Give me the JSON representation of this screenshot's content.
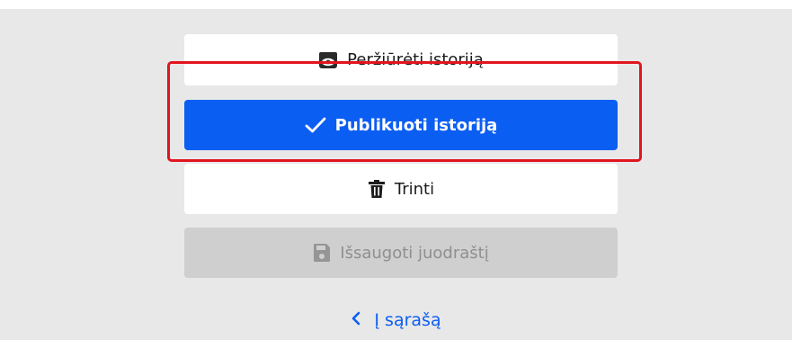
{
  "actions": {
    "preview_label": "Peržiūrėti istoriją",
    "preview_icon": "eye-icon",
    "publish_label": "Publikuoti istoriją",
    "publish_icon": "checkmark-icon",
    "delete_label": "Trinti",
    "delete_icon": "trash-icon",
    "save_draft_label": "Išsaugoti juodraštį",
    "save_draft_icon": "floppy-disk-icon",
    "save_draft_state": "disabled"
  },
  "navigation": {
    "back_label": "Į sąrašą",
    "back_icon": "chevron-left-icon"
  },
  "colors": {
    "primary": "#0b5ef2",
    "highlight": "#e2141e",
    "panel_bg": "#e8e8e8",
    "disabled_bg": "#cfcfcf"
  }
}
